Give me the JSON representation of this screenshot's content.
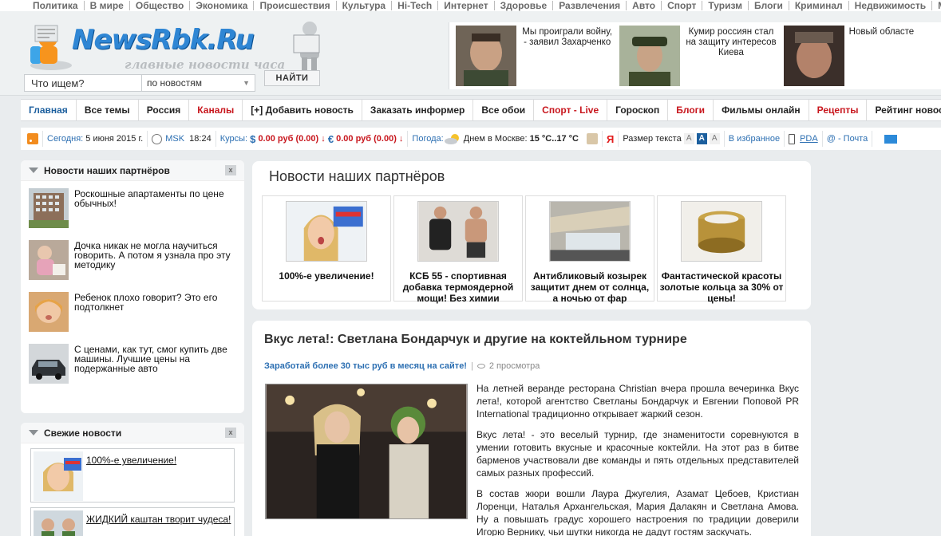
{
  "top_categories": [
    "Политика",
    "В мире",
    "Общество",
    "Экономика",
    "Происшествия",
    "Культура",
    "Hi-Tech",
    "Интернет",
    "Здоровье",
    "Развлечения",
    "Авто",
    "Спорт",
    "Туризм",
    "Блоги",
    "Криминал",
    "Недвижимость",
    "Му"
  ],
  "logo": {
    "name": "NewsRbk.Ru",
    "slogan": "главные новости часа"
  },
  "search": {
    "value": "Что ищем?",
    "scope": "по новостям",
    "button": "НАЙТИ"
  },
  "top_news": [
    {
      "text": "Мы проиграли войну, - заявил Захарченко",
      "icon": "news-photo"
    },
    {
      "text": "Кумир россиян стал на защиту интересов Киева",
      "icon": "news-photo"
    },
    {
      "text": "Новый областе",
      "icon": "news-photo"
    }
  ],
  "main_menu": [
    {
      "label": "Главная",
      "style": "first"
    },
    {
      "label": "Все темы",
      "style": ""
    },
    {
      "label": "Россия",
      "style": ""
    },
    {
      "label": "Каналы",
      "style": "red"
    },
    {
      "label": "[+] Добавить новость",
      "style": ""
    },
    {
      "label": "Заказать информер",
      "style": ""
    },
    {
      "label": "Все обои",
      "style": ""
    },
    {
      "label": "Спорт - Live",
      "style": "red"
    },
    {
      "label": "Гороскоп",
      "style": ""
    },
    {
      "label": "Блоги",
      "style": "red"
    },
    {
      "label": "Фильмы онлайн",
      "style": ""
    },
    {
      "label": "Рецепты",
      "style": "red"
    },
    {
      "label": "Рейтинг новосте",
      "style": ""
    }
  ],
  "info": {
    "today_label": "Сегодня:",
    "date": "5 июня 2015 г.",
    "tz": "MSK",
    "time": "18:24",
    "rates_label": "Курсы:",
    "usd": "0.00 руб (0.00)",
    "eur": "0.00 руб (0.00)",
    "weather_label": "Погода:",
    "weather_text": "Днем в Москве:",
    "temp": "15 °C..17 °C",
    "yandex": "Я",
    "font_size_label": "Размер текста",
    "font_sizes": [
      "A",
      "A",
      "A"
    ],
    "favorites": "В избранное",
    "pda": "PDA",
    "mail": "@ - Почта",
    "accent": "#2c6fb2",
    "red": "#c8161d"
  },
  "left_partners": {
    "title": "Новости наших партнёров",
    "close": "x",
    "items": [
      {
        "text": "Роскошные апартаменты по цене обычных!"
      },
      {
        "text": "Дочка никак не могла научиться говорить. А потом я узнала про эту методику"
      },
      {
        "text": "Ребенок плохо говорит? Это его подтолкнет"
      },
      {
        "text": "С ценами, как тут, смог купить две машины. Лучшие цены на подержанные авто"
      }
    ]
  },
  "fresh": {
    "title": "Свежие новости",
    "close": "x",
    "items": [
      {
        "text": "100%-е увеличение!"
      },
      {
        "text": "ЖИДКИЙ каштан творит чудеса!"
      }
    ]
  },
  "right_partners": {
    "title": "Новости наших партнёров",
    "cards": [
      {
        "text": "100%-е увеличение!"
      },
      {
        "text": "КСБ 55 - спортивная добавка термоядерной мощи! Без химии"
      },
      {
        "text": "Антибликовый козырек защитит днем от солнца, а ночью от фар"
      },
      {
        "text": "Фантастической красоты золотые кольца за 30% от цены!"
      }
    ]
  },
  "article": {
    "title": "Вкус лета!: Светлана Бондарчук и другие на коктейльном турнире",
    "promo": "Заработай более 30 тыс руб в месяц на сайте!",
    "views": "2 просмотра",
    "paragraphs": [
      "На летней веранде ресторана Christian вчера прошла вечеринка Вкус лета!, которой агентство Светланы Бондарчук и Евгении Поповой PR International традиционно открывает жаркий сезон.",
      "Вкус лета! - это веселый турнир, где знаменитости соревнуются в умении готовить вкусные и красочные коктейли. На этот раз в битве барменов участвовали две команды и пять отдельных представителей самых разных профессий.",
      "В состав жюри вошли Лаура Джугелия, Азамат Цебоев, Кристиан Лоренци, Наталья Архангельская, Мария Далакян и Светлана Амова. Ну а повышать градус хорошего настроения по традиции доверили Игорю Вернику, чьи шутки никогда не дадут гостям заскучать."
    ]
  }
}
